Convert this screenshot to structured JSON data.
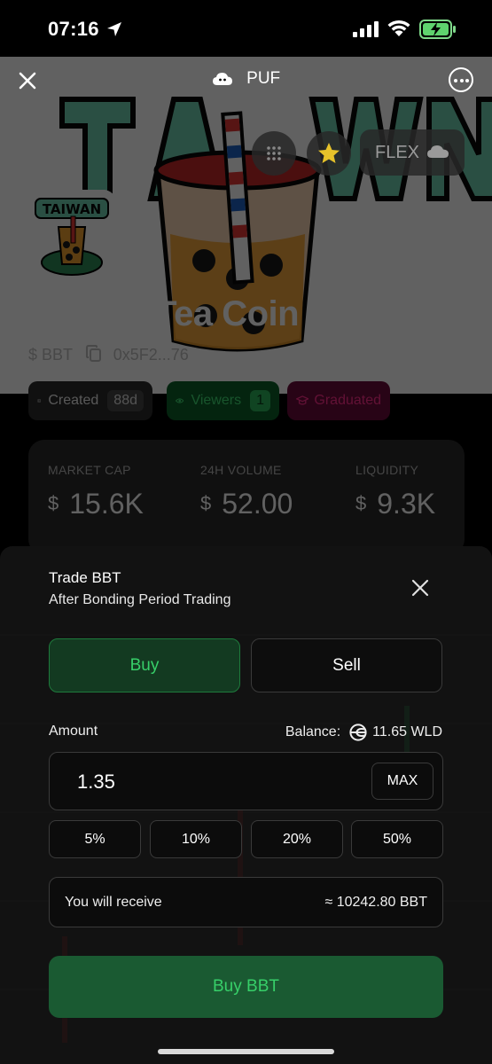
{
  "status_bar": {
    "time": "07:16"
  },
  "header": {
    "brand": "PUF"
  },
  "floating": {
    "flex_label": "FLEX"
  },
  "token": {
    "logo_text": "TAIWAN",
    "name": "Bubble Tea Coin",
    "symbol": "$ BBT",
    "address": "0x5F2...76",
    "tags": {
      "created_label": "Created",
      "created_value": "88d",
      "viewers_label": "Viewers",
      "viewers_value": "1",
      "graduated_label": "Graduated"
    },
    "stats": [
      {
        "label": "MARKET CAP",
        "currency": "$",
        "value": "15.6K"
      },
      {
        "label": "24H VOLUME",
        "currency": "$",
        "value": "52.00"
      },
      {
        "label": "LIQUIDITY",
        "currency": "$",
        "value": "9.3K"
      }
    ]
  },
  "trade": {
    "title": "Trade BBT",
    "subtitle": "After Bonding Period Trading",
    "tabs": {
      "buy": "Buy",
      "sell": "Sell"
    },
    "amount_label": "Amount",
    "balance_label": "Balance:",
    "balance_value": "11.65 WLD",
    "amount_value": "1.35",
    "max_label": "MAX",
    "percent_buttons": [
      "5%",
      "10%",
      "20%",
      "50%"
    ],
    "receive_label": "You will receive",
    "receive_value": "≈ 10242.80 BBT",
    "submit_label": "Buy BBT"
  },
  "colors": {
    "buy_green": "#37cf69",
    "graduated_pink": "#ff2e8c",
    "panel": "#2a2a2a",
    "sheet": "#121212"
  }
}
